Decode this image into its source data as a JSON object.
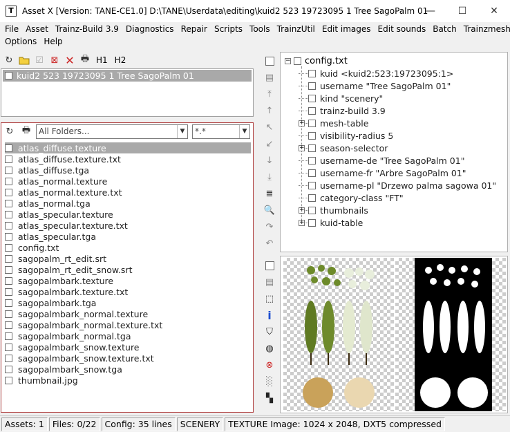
{
  "window": {
    "app_icon": "T",
    "title": "Asset X  [Version: TANE-CE1.0]  D:\\TANE\\Userdata\\editing\\kuid2 523 19723095 1 Tree SagoPalm 01",
    "minimize": "—",
    "maximize": "☐",
    "close": "✕"
  },
  "menu": {
    "row1": [
      "File",
      "Asset",
      "Trainz-Build 3.9",
      "Diagnostics",
      "Repair",
      "Scripts",
      "Tools",
      "TrainzUtil",
      "Edit images",
      "Edit sounds",
      "Batch",
      "Trainzmesh"
    ],
    "row2": [
      "Options",
      "Help"
    ]
  },
  "asset_toolbar": {
    "h1": "H1",
    "h2": "H2"
  },
  "assets": [
    {
      "label": "kuid2 523 19723095 1 Tree SagoPalm 01",
      "selected": true
    }
  ],
  "files": {
    "folder_combo": "All Folders...",
    "filter_combo": "*.*",
    "items": [
      {
        "name": "atlas_diffuse.texture",
        "selected": true
      },
      {
        "name": "atlas_diffuse.texture.txt"
      },
      {
        "name": "atlas_diffuse.tga"
      },
      {
        "name": "atlas_normal.texture"
      },
      {
        "name": "atlas_normal.texture.txt"
      },
      {
        "name": "atlas_normal.tga"
      },
      {
        "name": "atlas_specular.texture"
      },
      {
        "name": "atlas_specular.texture.txt"
      },
      {
        "name": "atlas_specular.tga"
      },
      {
        "name": "config.txt"
      },
      {
        "name": "sagopalm_rt_edit.srt"
      },
      {
        "name": "sagopalm_rt_edit_snow.srt"
      },
      {
        "name": "sagopalmbark.texture"
      },
      {
        "name": "sagopalmbark.texture.txt"
      },
      {
        "name": "sagopalmbark.tga"
      },
      {
        "name": "sagopalmbark_normal.texture"
      },
      {
        "name": "sagopalmbark_normal.texture.txt"
      },
      {
        "name": "sagopalmbark_normal.tga"
      },
      {
        "name": "sagopalmbark_snow.texture"
      },
      {
        "name": "sagopalmbark_snow.texture.txt"
      },
      {
        "name": "sagopalmbark_snow.tga"
      },
      {
        "name": "thumbnail.jpg"
      }
    ]
  },
  "config_tree": {
    "root": "config.txt",
    "nodes": [
      {
        "label": "kuid <kuid2:523:19723095:1>",
        "expandable": false
      },
      {
        "label": "username \"Tree SagoPalm 01\"",
        "expandable": false
      },
      {
        "label": "kind \"scenery\"",
        "expandable": false
      },
      {
        "label": "trainz-build 3.9",
        "expandable": false
      },
      {
        "label": "mesh-table",
        "expandable": true
      },
      {
        "label": "visibility-radius 5",
        "expandable": false
      },
      {
        "label": "season-selector",
        "expandable": true
      },
      {
        "label": "username-de \"Tree SagoPalm 01\"",
        "expandable": false
      },
      {
        "label": "username-fr \"Arbre SagoPalm 01\"",
        "expandable": false
      },
      {
        "label": "username-pl \"Drzewo palma sagowa 01\"",
        "expandable": false
      },
      {
        "label": "category-class \"FT\"",
        "expandable": false
      },
      {
        "label": "thumbnails",
        "expandable": true
      },
      {
        "label": "kuid-table",
        "expandable": true
      }
    ]
  },
  "status": {
    "assets": "Assets: 1",
    "files": "Files: 0/22",
    "config": "Config: 35 lines",
    "kind": "SCENERY",
    "texture": "TEXTURE Image: 1024 x 2048, DXT5 compressed"
  },
  "colors": {
    "selection": "#a9a9a9",
    "files_border": "#b04040",
    "info_icon": "#1f4fd0",
    "error_icon": "#cc2222"
  }
}
